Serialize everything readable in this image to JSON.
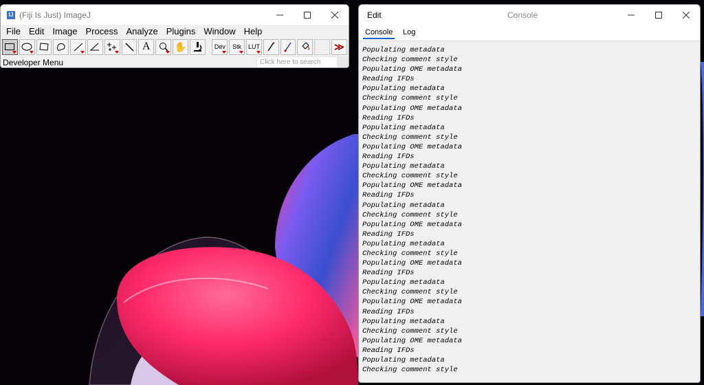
{
  "imagej": {
    "title": "(Fiji Is Just) ImageJ",
    "icon_label": "IJ",
    "menu": [
      "File",
      "Edit",
      "Image",
      "Process",
      "Analyze",
      "Plugins",
      "Window",
      "Help"
    ],
    "tools": [
      {
        "name": "rectangle-tool",
        "icon": "rectangle"
      },
      {
        "name": "oval-tool",
        "icon": "oval"
      },
      {
        "name": "polygon-tool",
        "icon": "polygon"
      },
      {
        "name": "freehand-tool",
        "icon": "freehand"
      },
      {
        "name": "line-tool",
        "icon": "line"
      },
      {
        "name": "angle-tool",
        "icon": "angle"
      },
      {
        "name": "multipoint-tool",
        "icon": "multipoint"
      },
      {
        "name": "wand-tool",
        "icon": "wand"
      },
      {
        "name": "text-tool",
        "icon": "text"
      },
      {
        "name": "magnifier-tool",
        "icon": "magnifier"
      },
      {
        "name": "scroll-tool",
        "icon": "hand"
      },
      {
        "name": "color-picker-tool",
        "icon": "microscope"
      }
    ],
    "extra_tools": [
      {
        "name": "dev-menu-tool",
        "label": "Dev"
      },
      {
        "name": "stack-menu-tool",
        "label": "Stk"
      },
      {
        "name": "lut-menu-tool",
        "label": "LUT"
      }
    ],
    "status_text": "Developer Menu",
    "search_placeholder": "Click here to search"
  },
  "console": {
    "menu_label": "Edit",
    "title": "Console",
    "tabs": [
      "Console",
      "Log"
    ],
    "active_tab": "Console",
    "lines": [
      "Populating metadata",
      "Checking comment style",
      "Populating OME metadata",
      "Reading IFDs",
      "Populating metadata",
      "Checking comment style",
      "Populating OME metadata",
      "Reading IFDs",
      "Populating metadata",
      "Checking comment style",
      "Populating OME metadata",
      "Reading IFDs",
      "Populating metadata",
      "Checking comment style",
      "Populating OME metadata",
      "Reading IFDs",
      "Populating metadata",
      "Checking comment style",
      "Populating OME metadata",
      "Reading IFDs",
      "Populating metadata",
      "Checking comment style",
      "Populating OME metadata",
      "Reading IFDs",
      "Populating metadata",
      "Checking comment style",
      "Populating OME metadata",
      "Reading IFDs",
      "Populating metadata",
      "Checking comment style",
      "Populating OME metadata",
      "Reading IFDs",
      "Populating metadata",
      "Checking comment style"
    ]
  },
  "colors": {
    "desktop_bg": "#050308",
    "accent_tab": "#0a64c8",
    "wallpaper_pink": "#ff2a6a",
    "wallpaper_blue": "#3a4fd0"
  }
}
